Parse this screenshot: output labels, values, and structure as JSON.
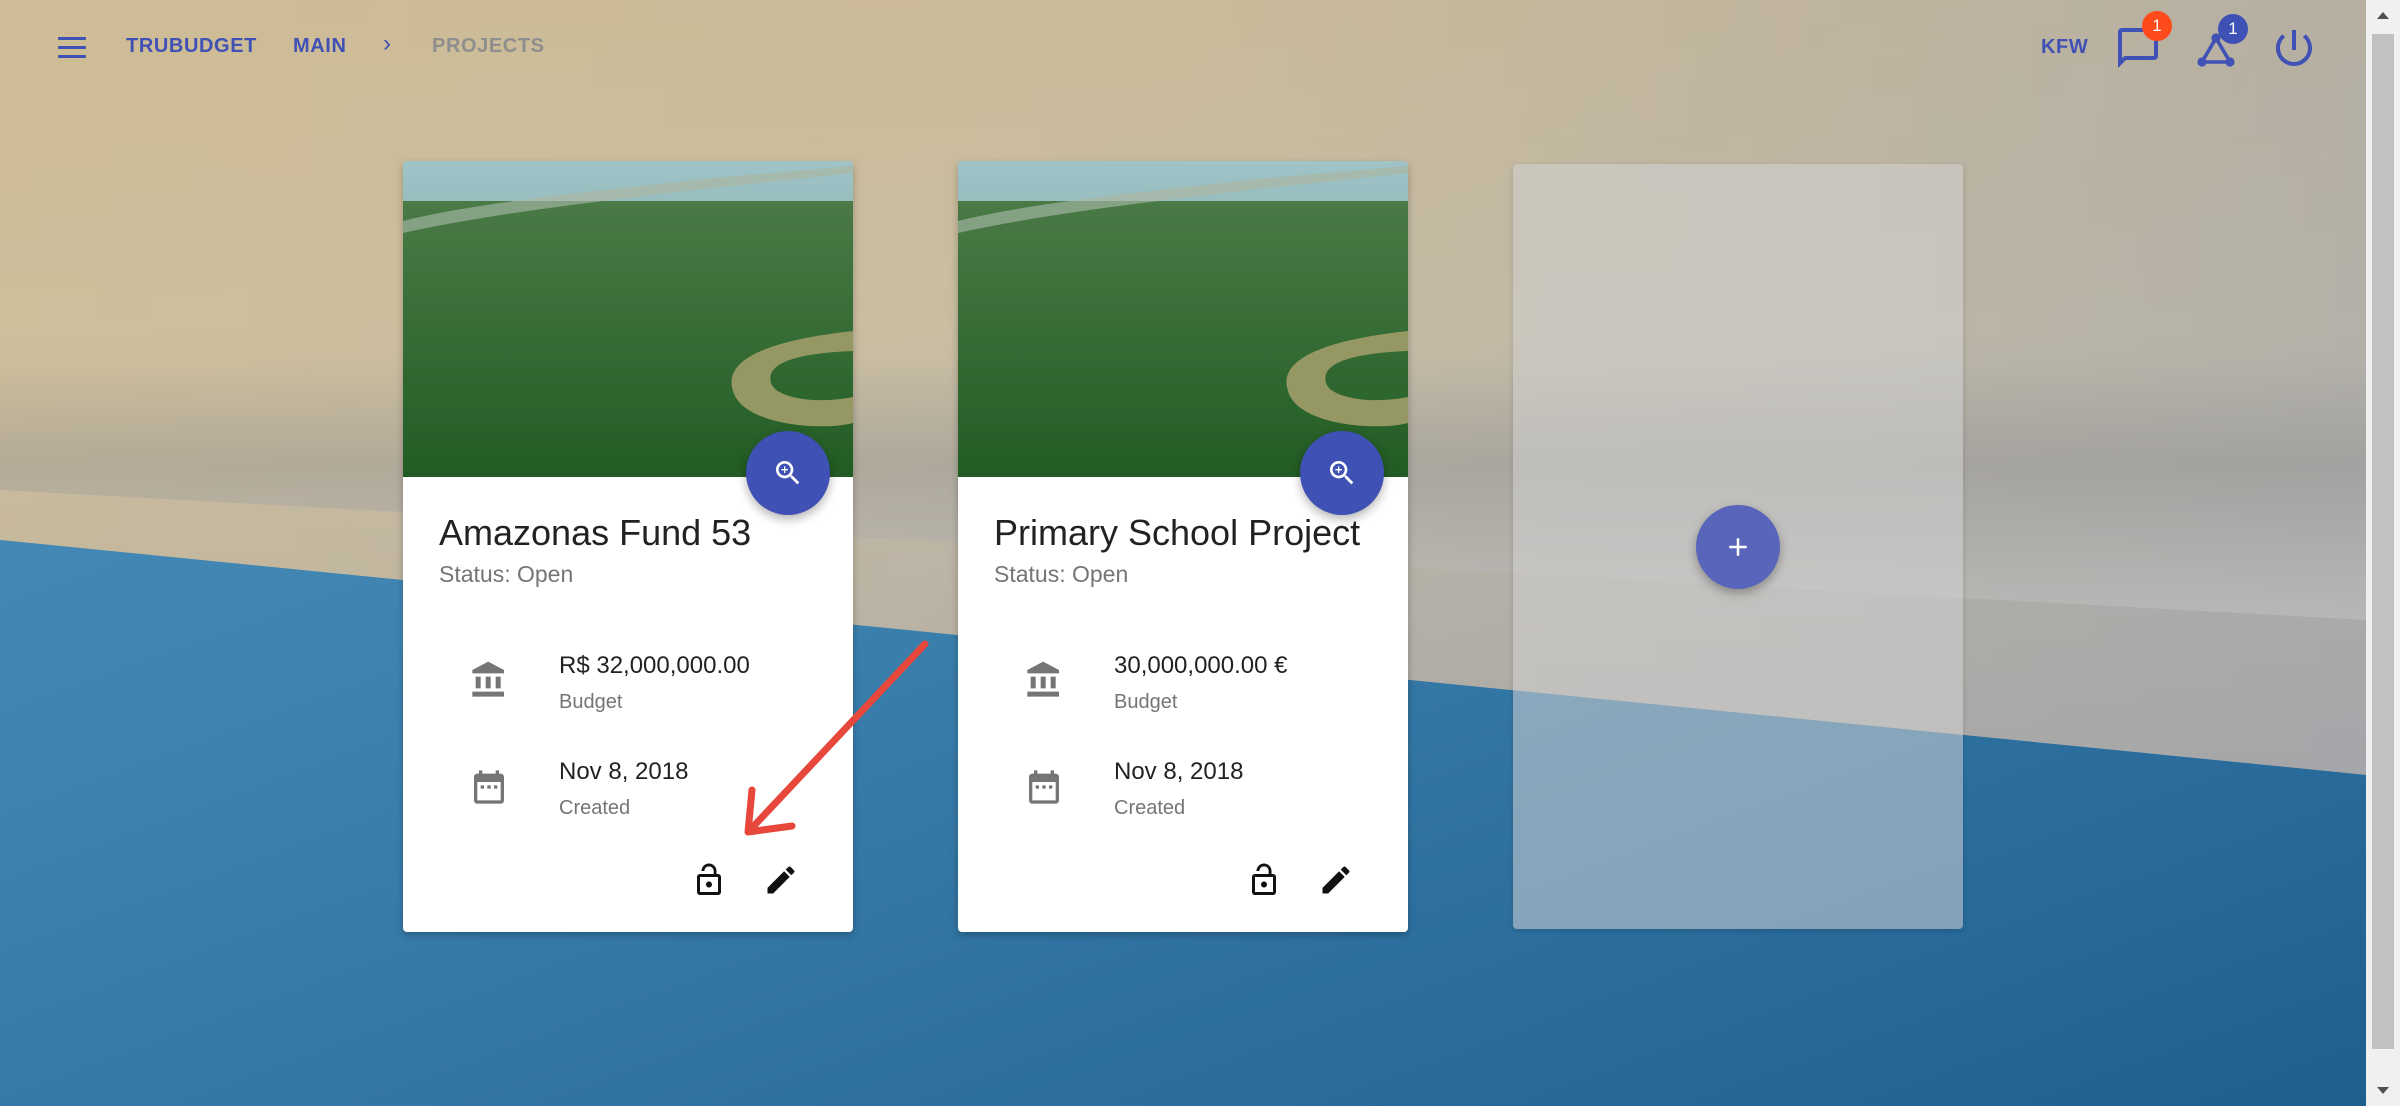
{
  "app": {
    "brand": "TRUBUDGET",
    "breadcrumb": [
      "MAIN",
      "PROJECTS"
    ],
    "organization": "KFW",
    "notifications_count": "1",
    "peers_count": "1"
  },
  "colors": {
    "primary": "#3f51b5",
    "badge_notifications": "#ff4a1c",
    "badge_peers": "#3f51b5",
    "annotation_arrow": "#e8473b"
  },
  "icons": {
    "menu": "hamburger-menu-icon",
    "notifications": "chat-bubble-icon",
    "peers": "network-icon",
    "logout": "power-icon",
    "view": "zoom-in-icon",
    "budget": "bank-icon",
    "created": "calendar-icon",
    "permissions": "lock-open-icon",
    "edit": "pencil-icon",
    "add": "plus-icon"
  },
  "projects": [
    {
      "title": "Amazonas Fund 53",
      "status": "Status: Open",
      "budget_value": "R$ 32,000,000.00",
      "budget_label": "Budget",
      "created_value": "Nov 8, 2018",
      "created_label": "Created"
    },
    {
      "title": "Primary School Project",
      "status": "Status: Open",
      "budget_value": "30,000,000.00 €",
      "budget_label": "Budget",
      "created_value": "Nov 8, 2018",
      "created_label": "Created"
    }
  ]
}
